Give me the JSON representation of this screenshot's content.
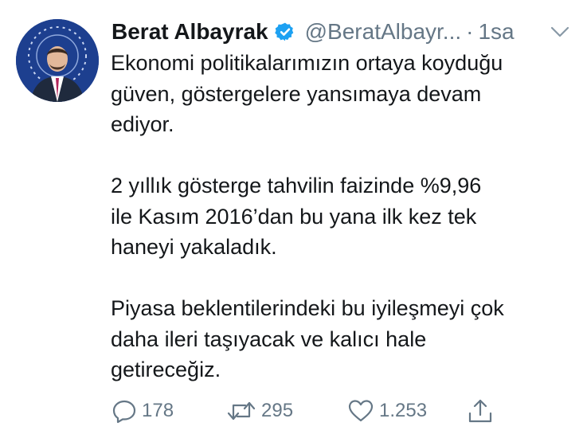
{
  "tweet": {
    "author_name": "Berat Albayrak",
    "handle": "@BeratAlbayr...",
    "separator": "·",
    "time": "1sa",
    "verified": true,
    "paragraphs": [
      "Ekonomi politikalarımızın ortaya koyduğu\ngüven, göstergelere yansımaya devam\nediyor.",
      "2 yıllık gösterge tahvilin faizinde %9,96\nile Kasım 2016’dan bu yana ilk kez tek\nhaneyi yakaladık.",
      "Piyasa beklentilerindeki bu iyileşmeyi çok\ndaha ileri taşıyacak ve kalıcı hale\ngetireceğiz."
    ]
  },
  "actions": {
    "reply": {
      "icon": "reply-icon",
      "count": "178"
    },
    "retweet": {
      "icon": "retweet-icon",
      "count": "295"
    },
    "like": {
      "icon": "heart-icon",
      "count": "1.253"
    },
    "share": {
      "icon": "share-icon"
    }
  },
  "colors": {
    "text": "#14171a",
    "muted": "#657786",
    "verified_blue": "#1da1f2",
    "avatar_bg": "#1d3f8f"
  }
}
